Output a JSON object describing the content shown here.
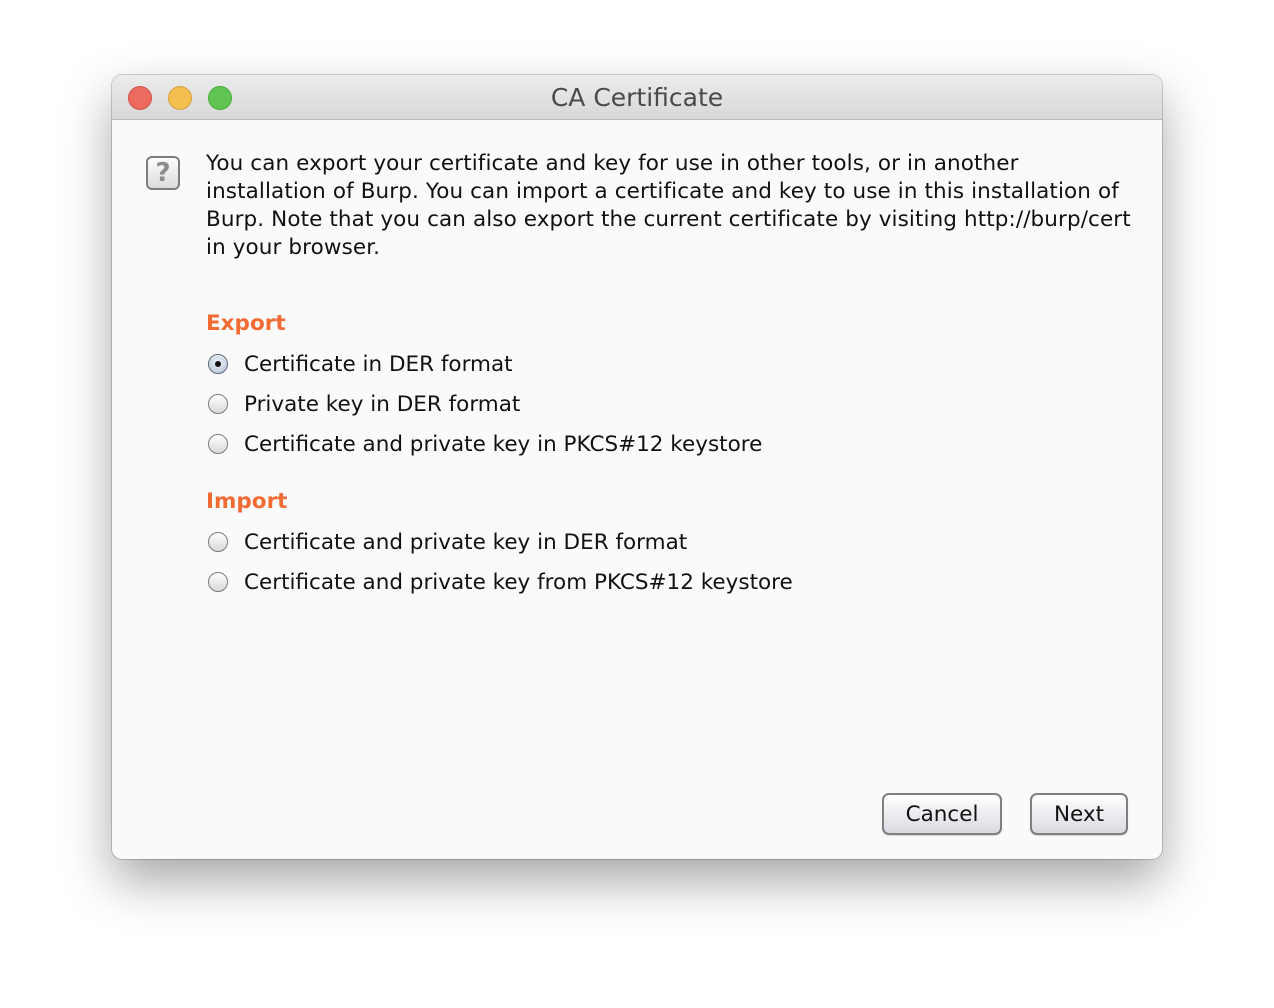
{
  "window": {
    "title": "CA Certificate"
  },
  "icons": {
    "help": "?"
  },
  "description": "You can export your certificate and key for use in other tools, or in another installation of Burp. You can import a certificate and key to use in this installation of Burp. Note that you can also export the current certificate by visiting http://burp/cert in your browser.",
  "export": {
    "title": "Export",
    "options": [
      {
        "label": "Certificate in DER format",
        "checked": true
      },
      {
        "label": "Private key in DER format",
        "checked": false
      },
      {
        "label": "Certificate and private key in PKCS#12 keystore",
        "checked": false
      }
    ]
  },
  "import": {
    "title": "Import",
    "options": [
      {
        "label": "Certificate and private key in DER format",
        "checked": false
      },
      {
        "label": "Certificate and private key from PKCS#12 keystore",
        "checked": false
      }
    ]
  },
  "buttons": {
    "cancel": "Cancel",
    "next": "Next"
  },
  "colors": {
    "section_title": "#f26b33"
  }
}
